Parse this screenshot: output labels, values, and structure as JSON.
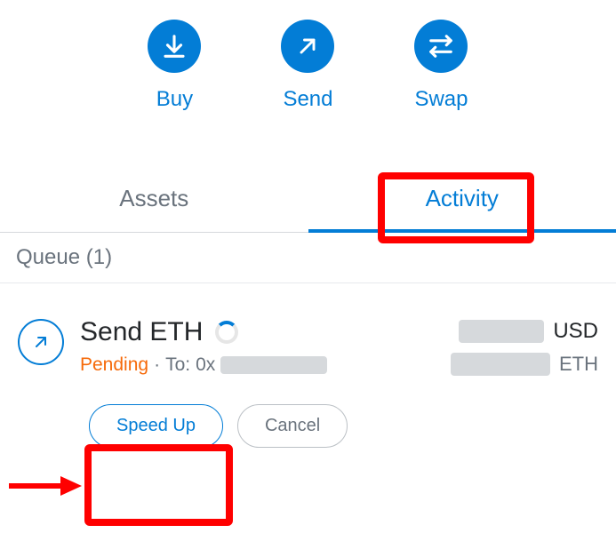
{
  "actions": {
    "buy": "Buy",
    "send": "Send",
    "swap": "Swap"
  },
  "tabs": {
    "assets": "Assets",
    "activity": "Activity"
  },
  "queue": {
    "label": "Queue (1)"
  },
  "tx": {
    "title": "Send ETH",
    "status": "Pending",
    "dot": "·",
    "to_label": "To:",
    "to_prefix": "0x",
    "primary_currency": "USD",
    "secondary_currency": "ETH"
  },
  "buttons": {
    "speedup": "Speed Up",
    "cancel": "Cancel"
  },
  "colors": {
    "accent": "#037dd6",
    "pending": "#f66a0a",
    "highlight": "#ff0000"
  }
}
